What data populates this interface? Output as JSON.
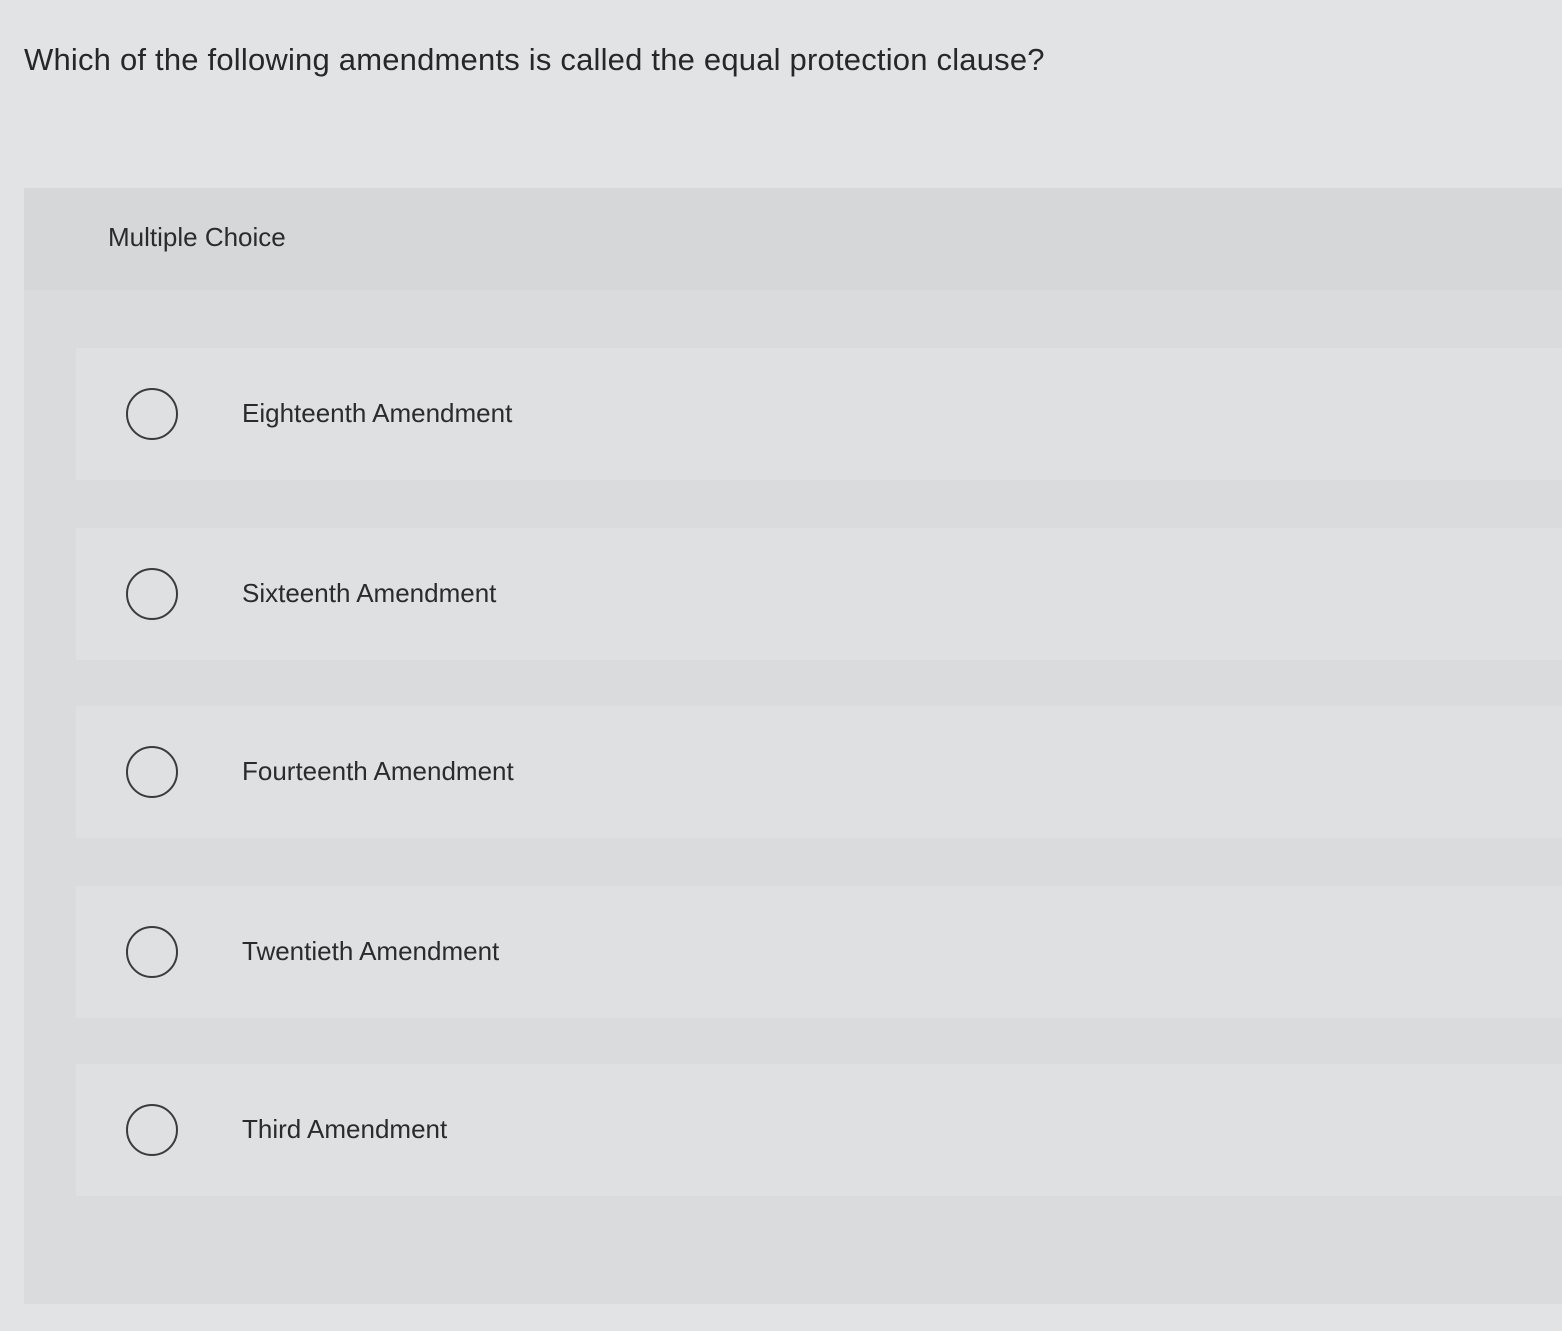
{
  "question": {
    "text": "Which of the following amendments is called the equal protection clause?"
  },
  "multiple_choice": {
    "label": "Multiple Choice",
    "options": [
      {
        "label": "Eighteenth Amendment",
        "selected": false
      },
      {
        "label": "Sixteenth Amendment",
        "selected": false
      },
      {
        "label": "Fourteenth Amendment",
        "selected": false
      },
      {
        "label": "Twentieth Amendment",
        "selected": false
      },
      {
        "label": "Third Amendment",
        "selected": false
      }
    ]
  }
}
